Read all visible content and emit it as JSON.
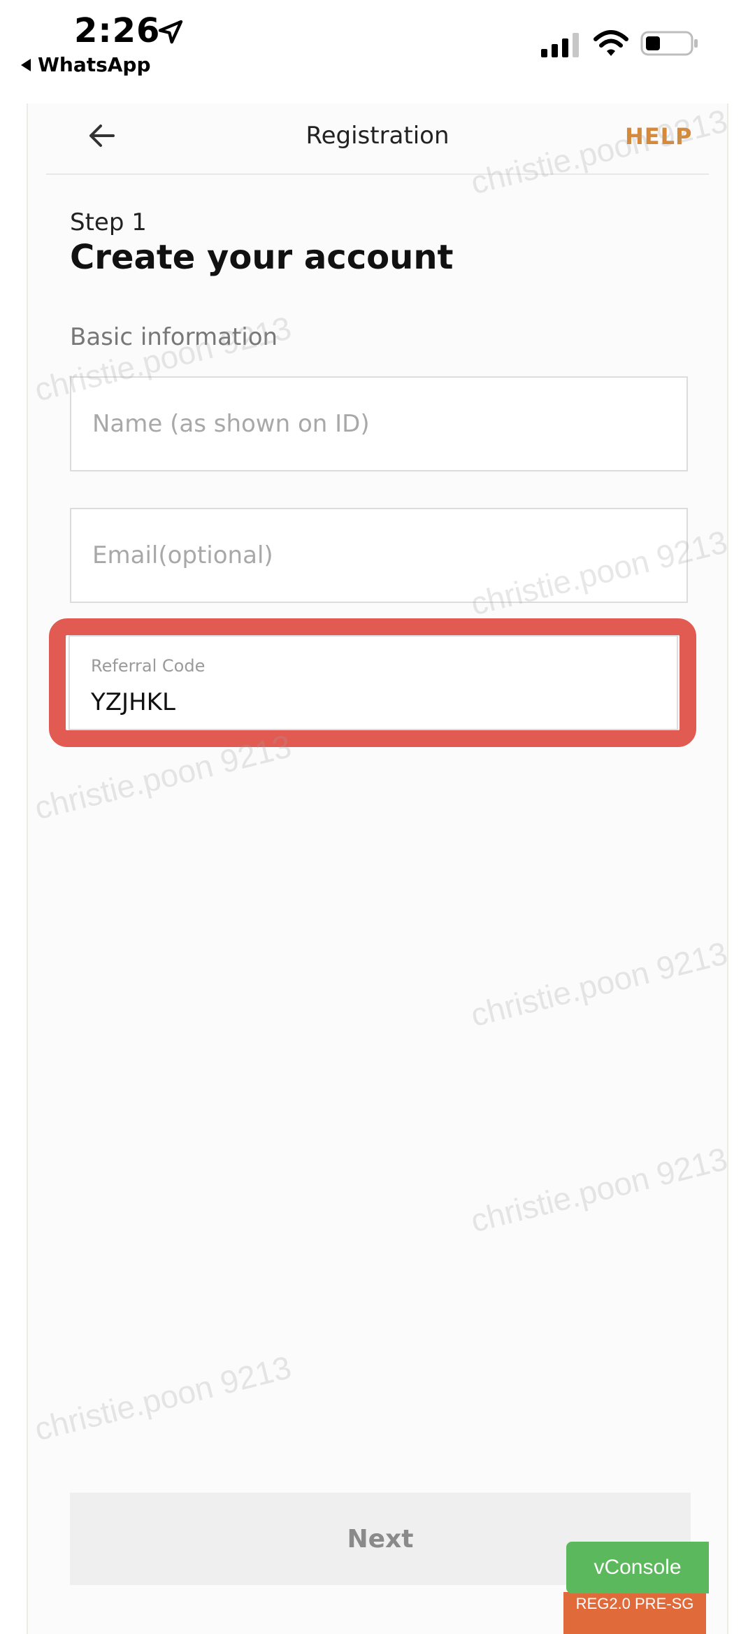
{
  "status_bar": {
    "time": "2:26",
    "back_app": "WhatsApp",
    "icons": [
      "location-arrow-icon",
      "cellular-signal-icon",
      "wifi-icon",
      "battery-icon"
    ]
  },
  "nav": {
    "title": "Registration",
    "help": "HELP",
    "back_icon": "arrow-left-icon"
  },
  "form": {
    "step": "Step 1",
    "title": "Create your account",
    "section": "Basic information",
    "name_placeholder": "Name (as shown on ID)",
    "name_value": "",
    "email_placeholder": "Email(optional)",
    "email_value": "",
    "referral_label": "Referral Code",
    "referral_value": "YZJHKL"
  },
  "next_button": "Next",
  "vconsole": "vConsole",
  "env_badge": "REG2.0 PRE-SG",
  "watermark": "christie.poon 9213",
  "colors": {
    "accent_help": "#d48a3a",
    "highlight": "#e25b53",
    "vconsole": "#5cb85c",
    "badge": "#e06a3a"
  }
}
